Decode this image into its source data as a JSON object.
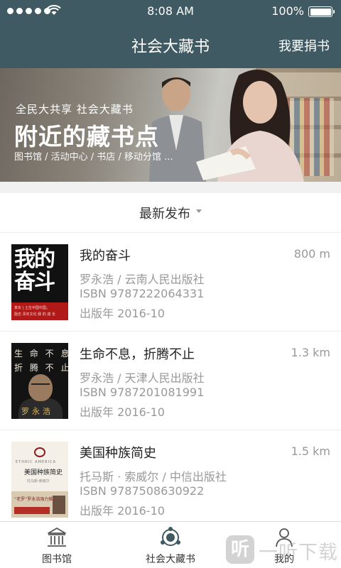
{
  "status_bar": {
    "time": "8:08 AM",
    "battery": "100%"
  },
  "nav": {
    "title": "社会大藏书",
    "action": "我要捐书"
  },
  "banner": {
    "subtitle": "全民大共享 社会大藏书",
    "title": "附近的藏书点",
    "tags": "图书馆 / 活动中心 / 书店 / 移动分馆 ..."
  },
  "sort": {
    "label": "最新发布"
  },
  "books": [
    {
      "title": "我的奋斗",
      "distance": "800 m",
      "author_publisher": "罗永浩  /  云南人民出版社",
      "isbn": "ISBN 9787222064331",
      "year": "出版年 2016-10",
      "cover": {
        "big_text": "我的奋斗",
        "band_line1": "真实 | 土生中国中国，",
        "band_line2": "励志 青年文化 我 的 成 长 "
      }
    },
    {
      "title": "生命不息，折腾不止",
      "distance": "1.3 km",
      "author_publisher": "罗永浩  /  天津人民出版社",
      "isbn": "ISBN 9787201081991",
      "year": "出版年 2016-10",
      "cover": {
        "line1": "生 命 不 息",
        "line2": "折 腾 不 止",
        "author": "罗永浩"
      }
    },
    {
      "title": "美国种族简史",
      "distance": "1.5 km",
      "author_publisher": "托马斯 · 索威尔  /  中信出版社",
      "isbn": "ISBN 9787508630922",
      "year": "出版年 2016-10",
      "cover": {
        "en": "ETHNIC AMERICA",
        "title": "美国种族简史",
        "author": "托马斯·索威尔",
        "red": "“老罗”罗永浩强力推荐"
      }
    }
  ],
  "tabs": [
    {
      "label": "图书馆",
      "icon": "library-icon"
    },
    {
      "label": "社会大藏书",
      "icon": "community-books-icon"
    },
    {
      "label": "我的",
      "icon": "user-icon"
    }
  ],
  "watermark": {
    "icon": "听",
    "text": "一听下载"
  },
  "colors": {
    "nav_bg": "#3f5a62",
    "accent_red": "#b01917"
  }
}
